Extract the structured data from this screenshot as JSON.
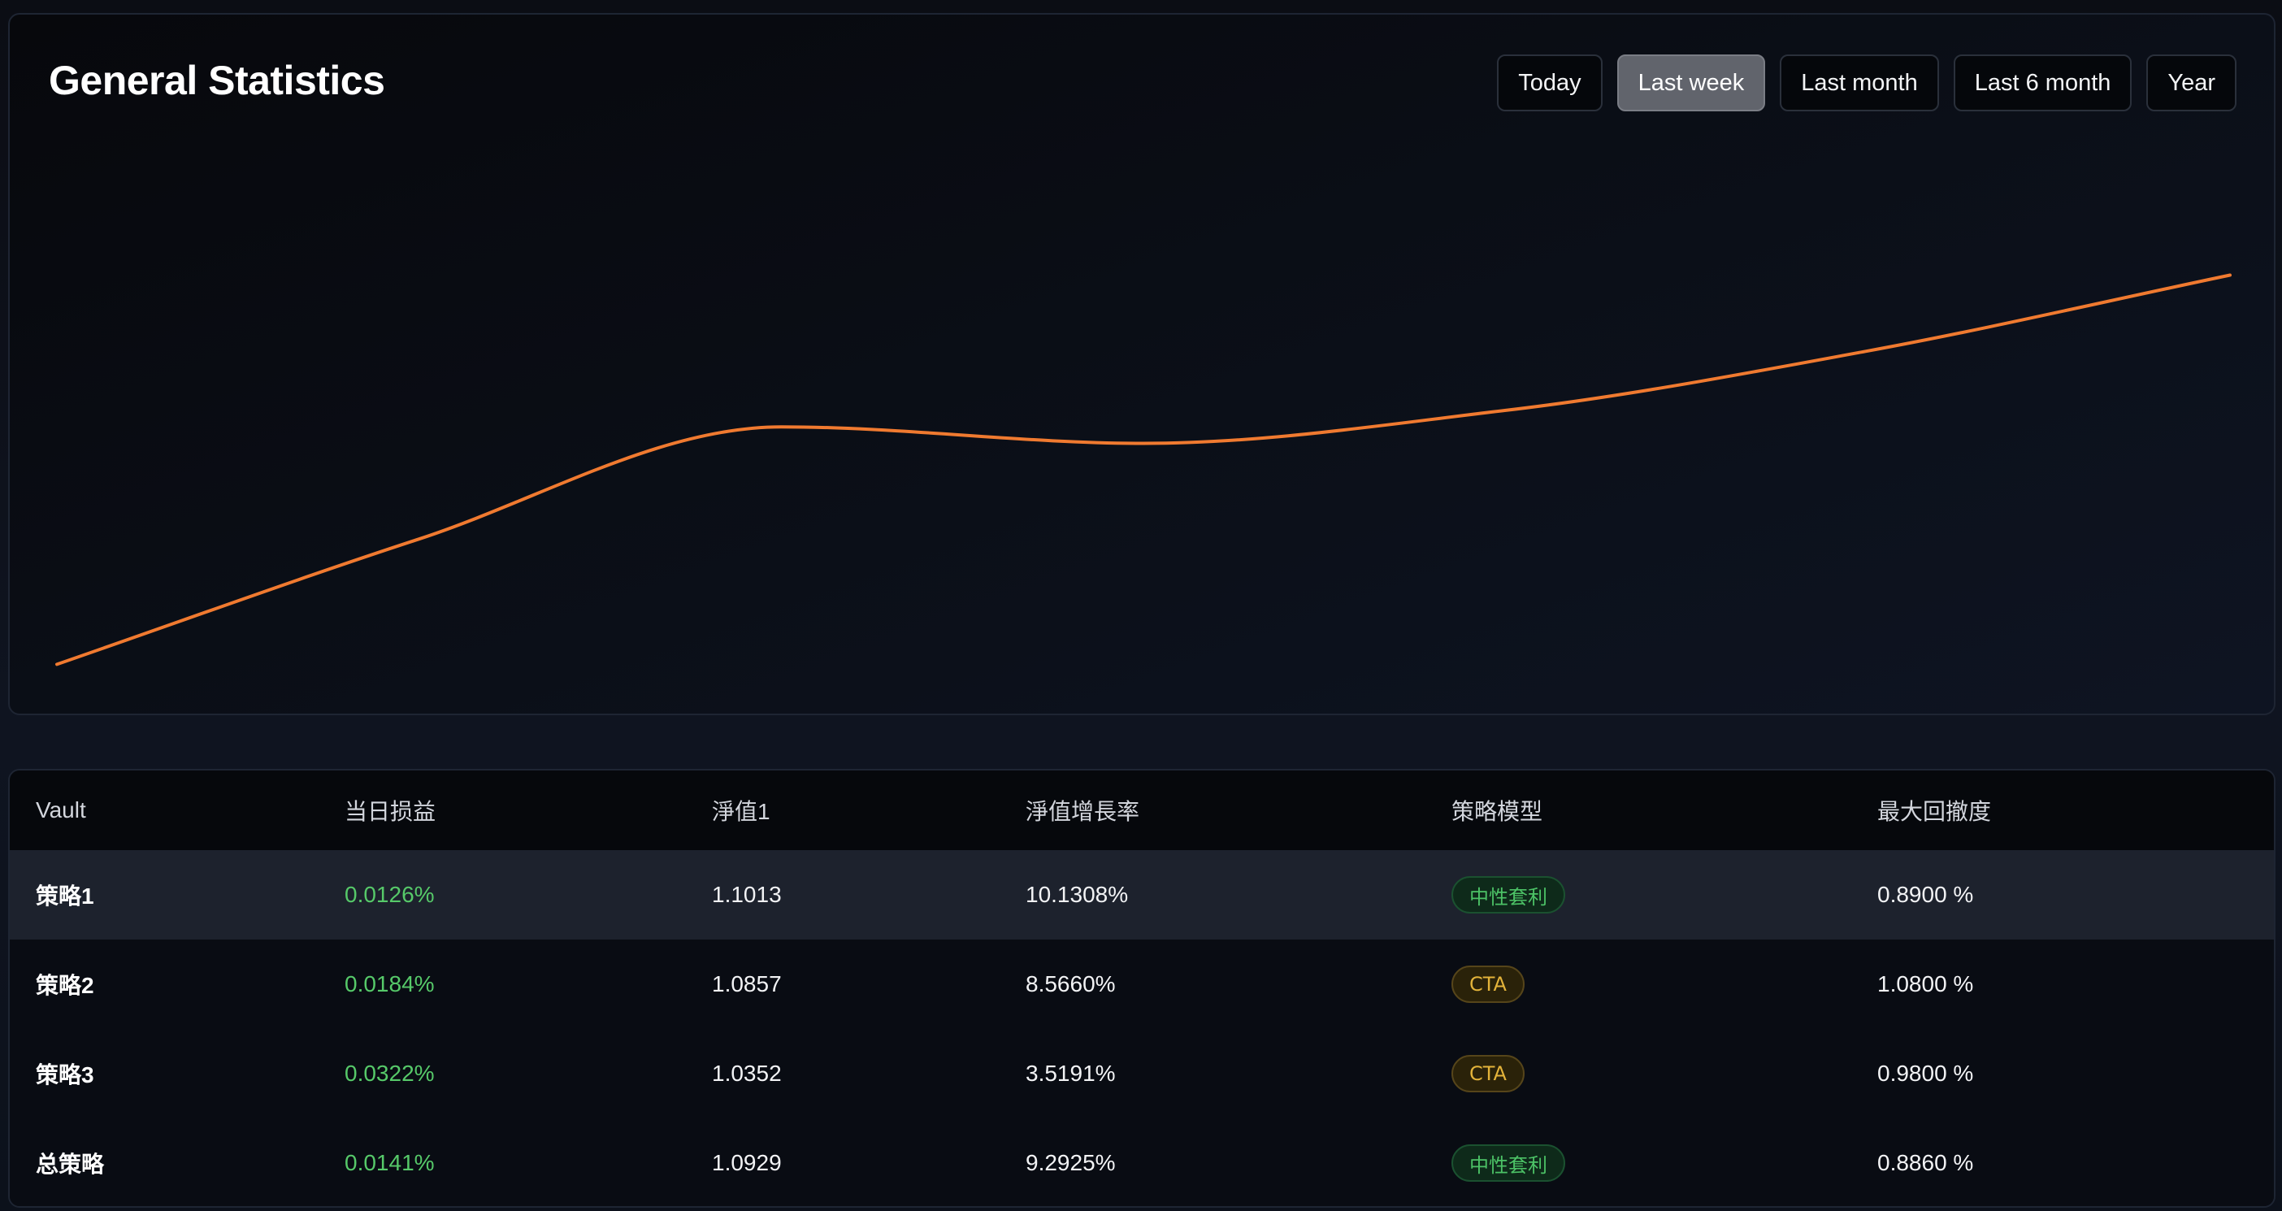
{
  "stats": {
    "title": "General Statistics",
    "ranges": [
      "Today",
      "Last week",
      "Last month",
      "Last 6 month",
      "Year"
    ],
    "selected_range": "Last week"
  },
  "chart_data": {
    "type": "line",
    "x": [
      1,
      2,
      3,
      4,
      5,
      6,
      7
    ],
    "series": [
      {
        "values": [
          1.0,
          1.38,
          1.72,
          1.67,
          1.77,
          1.95,
          2.18
        ]
      }
    ],
    "ylim": [
      0.9,
      2.6
    ],
    "grid": false,
    "line_color": "#f07a30",
    "xlabel": "",
    "ylabel": ""
  },
  "table": {
    "columns": [
      "Vault",
      "当日损益",
      "淨值1",
      "淨值增長率",
      "策略模型",
      "最大回撤度"
    ],
    "rows": [
      {
        "vault": "策略1",
        "pnl": "0.0126%",
        "nav": "1.1013",
        "growth": "10.1308%",
        "model": "中性套利",
        "model_color": "green",
        "drawdown": "0.8900 %"
      },
      {
        "vault": "策略2",
        "pnl": "0.0184%",
        "nav": "1.0857",
        "growth": "8.5660%",
        "model": "CTA",
        "model_color": "amber",
        "drawdown": "1.0800 %"
      },
      {
        "vault": "策略3",
        "pnl": "0.0322%",
        "nav": "1.0352",
        "growth": "3.5191%",
        "model": "CTA",
        "model_color": "amber",
        "drawdown": "0.9800 %"
      },
      {
        "vault": "总策略",
        "pnl": "0.0141%",
        "nav": "1.0929",
        "growth": "9.2925%",
        "model": "中性套利",
        "model_color": "green",
        "drawdown": "0.8860 %"
      }
    ]
  },
  "colors": {
    "pnl_positive": "#56c969",
    "badge_green": "#4cc266",
    "badge_amber": "#e3b33a",
    "active_range_bg": "#61646c"
  }
}
